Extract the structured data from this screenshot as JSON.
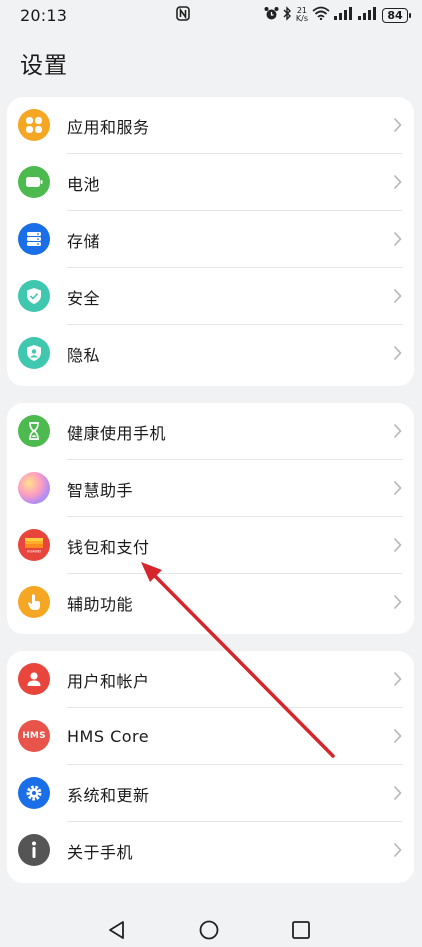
{
  "status_bar": {
    "time": "20:13",
    "net_speed_value": "21",
    "net_speed_unit": "K/s",
    "battery_level": "84"
  },
  "page_title": "设置",
  "groups": [
    {
      "items": [
        {
          "label": "应用和服务",
          "icon": "apps-icon",
          "color": "#f5a623"
        },
        {
          "label": "电池",
          "icon": "battery-icon",
          "color": "#4cba4f"
        },
        {
          "label": "存储",
          "icon": "storage-icon",
          "color": "#1a6ee8"
        },
        {
          "label": "安全",
          "icon": "shield-icon",
          "color": "#3fc7b0"
        },
        {
          "label": "隐私",
          "icon": "privacy-icon",
          "color": "#3fc7b0"
        }
      ]
    },
    {
      "items": [
        {
          "label": "健康使用手机",
          "icon": "hourglass-icon",
          "color": "#4cba4f"
        },
        {
          "label": "智慧助手",
          "icon": "assistant-orb-icon",
          "color": "#e89ad8"
        },
        {
          "label": "钱包和支付",
          "icon": "wallet-icon",
          "color": "#e8453c"
        },
        {
          "label": "辅助功能",
          "icon": "hand-pointer-icon",
          "color": "#f5a623"
        }
      ]
    },
    {
      "items": [
        {
          "label": "用户和帐户",
          "icon": "user-icon",
          "color": "#e8453c"
        },
        {
          "label": "HMS Core",
          "icon": "hms-icon",
          "color": "#e8534a"
        },
        {
          "label": "系统和更新",
          "icon": "gear-icon",
          "color": "#1a6ee8"
        },
        {
          "label": "关于手机",
          "icon": "info-icon",
          "color": "#555555"
        }
      ]
    }
  ],
  "wallet_icon_text": "HUAWEI",
  "hms_icon_text": "HMS",
  "annotation_arrow_color": "#d6262b",
  "navigation": {
    "back": "back-icon",
    "home": "home-icon",
    "recents": "recents-icon"
  }
}
